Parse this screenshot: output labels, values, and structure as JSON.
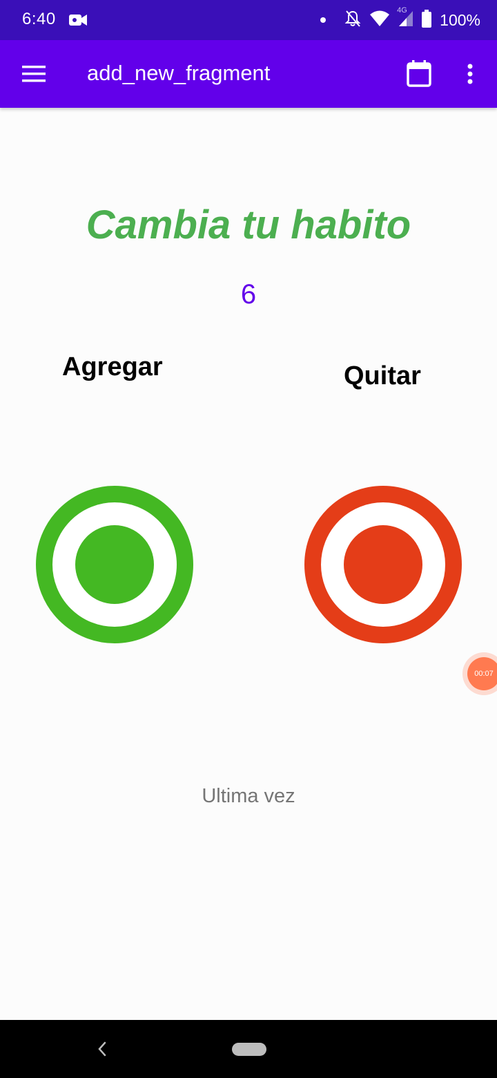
{
  "status_bar": {
    "time": "6:40",
    "battery": "100%",
    "network": "4G",
    "icons": [
      "video-camera-icon",
      "dot-icon",
      "notifications-off-icon",
      "wifi-icon",
      "cell-signal-icon",
      "battery-icon"
    ]
  },
  "app_bar": {
    "title": "add_new_fragment",
    "icons": [
      "menu-icon",
      "calendar-icon",
      "more-vert-icon"
    ],
    "background": "#6200ea"
  },
  "content": {
    "heading": "Cambia tu habito",
    "heading_color": "#4caf50",
    "counter": "6",
    "counter_color": "#6200ea",
    "add_label": "Agregar",
    "add_color": "#44b823",
    "remove_label": "Quitar",
    "remove_color": "#e43d18",
    "last_time_label": "Ultima vez"
  },
  "floating_timer": {
    "text": "00:07"
  },
  "nav_bar": {
    "icons": [
      "back-icon",
      "home-pill-icon"
    ]
  }
}
